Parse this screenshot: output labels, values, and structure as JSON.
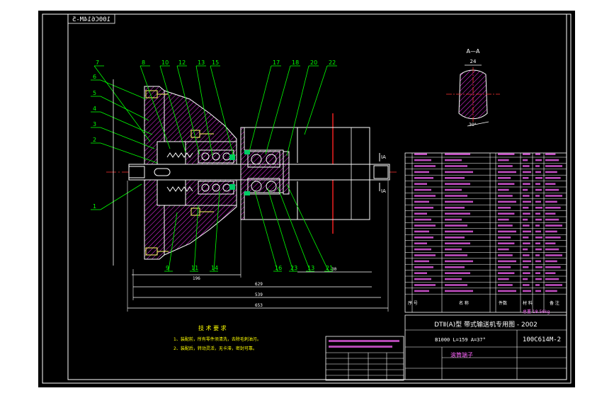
{
  "drawing": {
    "title_mirrored": "100C614M-5",
    "section_label": "A—A",
    "section_dim_top": "24",
    "section_dim_bottom": "30°",
    "part_numbers_top": [
      "7",
      "8",
      "10",
      "12",
      "13",
      "15",
      "17",
      "18",
      "20",
      "22"
    ],
    "part_numbers_left": [
      "6",
      "5",
      "4",
      "3",
      "2",
      "1"
    ],
    "part_numbers_bottom": [
      "9",
      "11",
      "14",
      "16",
      "23",
      "13",
      "21"
    ],
    "dims": {
      "overall": "653",
      "d1": "629",
      "d2": "539",
      "d3": "30",
      "d4": "196",
      "ia_top": "IA",
      "ia_bottom": "IA"
    },
    "tech_notes_title": "技 术 要 求",
    "tech_notes": [
      "1、装配前，所有零件须清洗，去除毛刺油污。",
      "2、装配后，转动灵活，无卡滞，密封可靠。"
    ]
  },
  "title_block": {
    "system_title": "DTⅡ(A)型  带式输送机专用图 - 2002",
    "spec": "B1000 L=159 A=37°",
    "drawing_no": "100C614M-2",
    "part_name": "滚筒端子",
    "header_seq": "序 号",
    "header_name": "名 称",
    "header_qty": "件数",
    "header_mat": "材 料",
    "header_remark": "备 注",
    "total_weight": "总重 18.56kg"
  },
  "colors": {
    "background": "#000000",
    "frame": "#ffffff",
    "outline": "#ffffff",
    "dim": "#ffffff",
    "leader": "#00ff00",
    "hatch": "#ff00ff",
    "center": "#ff3333",
    "table_text": "#ff66ff",
    "yellow": "#ffff00",
    "bolt": "#ffff66"
  }
}
